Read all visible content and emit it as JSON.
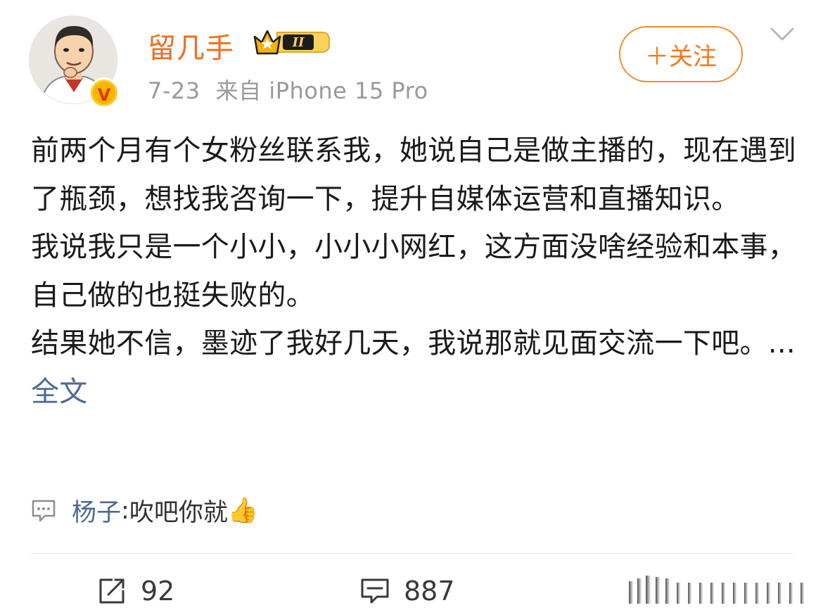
{
  "post": {
    "author": {
      "name": "留几手",
      "verified_mark": "V",
      "crown_level": "II",
      "avatar_icon": "cartoon-avatar-icon"
    },
    "date": "7-23",
    "source": "来自 iPhone 15 Pro",
    "follow_label": "＋关注",
    "paragraphs": [
      "前两个月有个女粉丝联系我，她说自己是做主播的，现在遇到了瓶颈，想找我咨询一下，提升自媒体运营和直播知识。",
      "我说我只是一个小小，小小小网红，这方面没啥经验和本事，自己做的也挺失败的。",
      "结果她不信，墨迹了我好几天，我说那就见面交流一下吧。"
    ],
    "ellipsis": "...",
    "more_label": "全文",
    "hot_comment": {
      "user": "杨子",
      "separator": ": ",
      "text": "吹吧你就",
      "emoji": "👍"
    },
    "actions": {
      "reposts": "92",
      "comments": "887"
    },
    "colors": {
      "accent_orange": "#f26d1c",
      "link_blue": "#4d6a91",
      "meta_gray": "#999999"
    }
  }
}
